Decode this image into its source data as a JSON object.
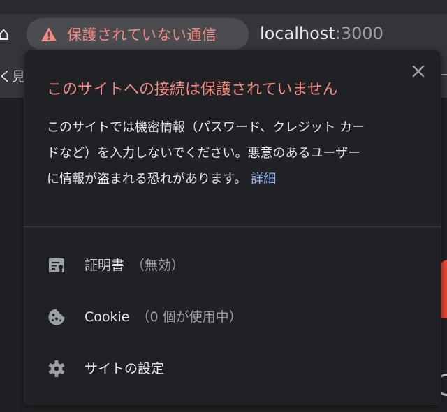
{
  "toolbar": {
    "security_chip_label": "保護されていない通信",
    "url_host": "localhost",
    "url_port": ":3000"
  },
  "bookmarks_bar": {
    "partial_text": "く見"
  },
  "popup": {
    "title": "このサイトへの接続は保護されていません",
    "body_line1": "このサイトでは機密情報（パスワード、クレジット カー",
    "body_line2": "ドなど）を入力しないでください。悪意のあるユーザー",
    "body_line3": "に情報が盗まれる恐れがあります。",
    "details_link": "詳細",
    "rows": [
      {
        "label": "証明書",
        "sub": "（無効）",
        "icon": "certificate-icon"
      },
      {
        "label": "Cookie",
        "sub": "（0 個が使用中）",
        "icon": "cookie-icon"
      },
      {
        "label": "サイトの設定",
        "sub": "",
        "icon": "gear-icon"
      }
    ]
  },
  "colors": {
    "warning_red": "#f28b82",
    "link_blue": "#8ab4f8",
    "popup_bg": "#202124",
    "chip_bg": "#4a4c50",
    "brand_red": "#ea4335"
  }
}
